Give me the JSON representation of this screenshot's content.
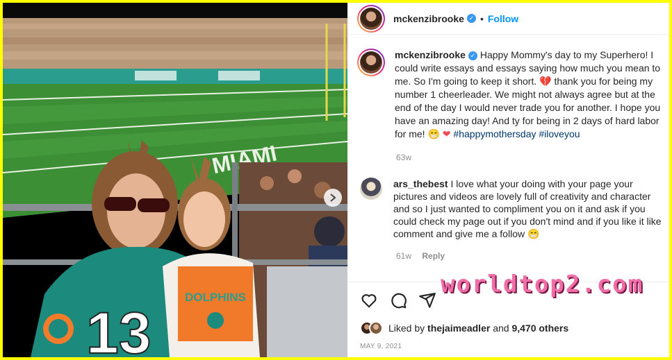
{
  "post": {
    "author": "mckenzibrooke",
    "follow_label": "Follow",
    "separator": "•"
  },
  "caption": {
    "author": "mckenzibrooke",
    "text_1": "Happy Mommy's day to my Superhero! I could write essays and essays saying how much you mean to me. So I'm going to keep it short.",
    "broken_heart": "💔",
    "text_2": "thank you for being my number 1 cheerleader. We might not always agree but at the end of the day I would never trade you for another. I hope you have an amazing day! And ty for being in 2 days of hard labor for me!",
    "grin": "😁",
    "heart": "❤",
    "tag_1": "#happymothersday",
    "tag_2": "#iloveyou",
    "age": "63w"
  },
  "comment": {
    "author": "ars_thebest",
    "text": "I love what your doing with your page your pictures and videos are lovely full of creativity and character and so I just wanted to compliment you on it and ask if you could check my page out if you don't mind and if you like it like comment and give me a follow",
    "emoji": "😁",
    "age": "61w",
    "reply_label": "Reply"
  },
  "likes": {
    "prefix": "Liked by",
    "user": "thejaimeadler",
    "and": "and",
    "count": "9,470 others"
  },
  "date": "MAY 9, 2021",
  "watermark": "worldtop2.com",
  "photo": {
    "jersey_number": "13",
    "jersey_text": "DOLPHINS",
    "field_text": "MIAMI"
  },
  "colors": {
    "border": "#ffff00",
    "link": "#0095f6",
    "hashtag": "#00376b",
    "muted": "#8e8e8e",
    "watermark": "#f06ea7"
  }
}
